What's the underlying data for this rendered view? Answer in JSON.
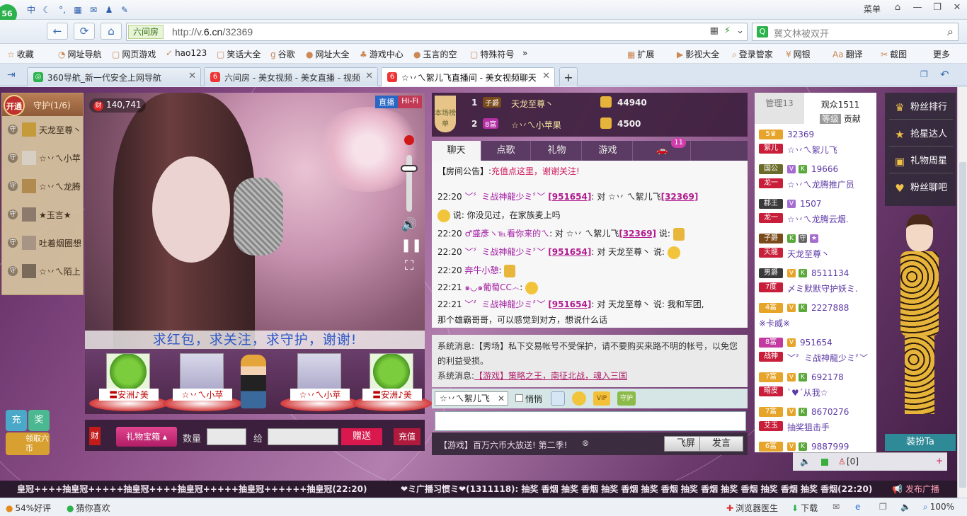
{
  "browser": {
    "logo_count": "56",
    "menu_label": "菜单",
    "toolbar_icons": [
      "中",
      "☾",
      "°,",
      "▦",
      "✉",
      "♟",
      "✎"
    ],
    "back": "←",
    "refresh": "⟳",
    "home": "⌂",
    "url_tag": "六间房",
    "url_prefix": "http://v.",
    "url_domain": "6.cn",
    "url_path": "/32369",
    "search_placeholder": "冀文林被双开",
    "favorites": [
      {
        "label": "收藏",
        "icon": "☆"
      },
      {
        "label": "网址导航",
        "icon": "◔"
      },
      {
        "label": "网页游戏",
        "icon": "▢"
      },
      {
        "label": "hao123",
        "icon": "✓"
      },
      {
        "label": "笑话大全",
        "icon": "▢"
      },
      {
        "label": "谷歌",
        "icon": "g"
      },
      {
        "label": "网址大全",
        "icon": "●"
      },
      {
        "label": "游戏中心",
        "icon": "♣"
      },
      {
        "label": "玉言的空",
        "icon": "●"
      },
      {
        "label": "特殊符号",
        "icon": "▢"
      },
      {
        "label": "»",
        "icon": ""
      }
    ],
    "right_favorites": [
      {
        "label": "扩展",
        "icon": "▦"
      },
      {
        "label": "影视大全",
        "icon": "▶"
      },
      {
        "label": "登录管家",
        "icon": "⌕"
      },
      {
        "label": "网银",
        "icon": "¥"
      },
      {
        "label": "翻译",
        "icon": "Aa"
      },
      {
        "label": "截图",
        "icon": "✂"
      },
      {
        "label": "更多",
        "icon": ""
      }
    ],
    "tabs": [
      {
        "title": "360导航_新一代安全上网导航",
        "icon": "◎"
      },
      {
        "title": "六间房 - 美女视频 - 美女直播 - 视频",
        "icon": "6"
      },
      {
        "title": "☆丷ㄟ絮儿飞直播间 - 美女视频聊天",
        "icon": "6"
      }
    ],
    "new_tab": "+"
  },
  "guard": {
    "open_label": "开通",
    "title": "守护(1/6)",
    "mark": "守",
    "members": [
      "天龙至尊丶",
      "☆丷ㄟ小苹",
      "☆丷ㄟ龙腾",
      "★玉言★",
      "吐着烟圈想",
      "☆丷ㄟ陌上"
    ]
  },
  "video": {
    "money_icon": "财",
    "money": "140,741",
    "live": "直播",
    "hifi": "Hi-Fi",
    "banner": "求红包，求关注，求守护，谢谢!",
    "vol_icon": "🔊",
    "pause_icon": "❚❚",
    "screen_icon": "⛶"
  },
  "seats": [
    {
      "name": "〓安洲♪美",
      "type": "alien"
    },
    {
      "name": "☆丷ㄟ小苹",
      "type": "girl"
    },
    {
      "name": "☆丷ㄟ小苹",
      "type": "girl"
    },
    {
      "name": "〓安洲♪美",
      "type": "alien"
    }
  ],
  "giftbar": {
    "cai": "财",
    "gift_box": "礼物宝箱 ▴",
    "qty_label": "数量",
    "to_label": "给",
    "send": "赠送",
    "charge": "充值"
  },
  "left_buttons": {
    "charge": "充",
    "prize": "奖",
    "collect": "领取六币"
  },
  "rank": {
    "badge": "本场榜单",
    "rows": [
      {
        "rank": "1",
        "level": "子爵",
        "name": "天龙至尊丶",
        "value": "44940"
      },
      {
        "rank": "2",
        "level": "8富",
        "name": "☆丷ㄟ小苹果",
        "value": "4500"
      }
    ]
  },
  "chat": {
    "tabs": [
      "聊天",
      "点歌",
      "礼物",
      "游戏",
      "🚗"
    ],
    "car_count": "11",
    "notice_prefix": "【房间公告】:",
    "notice": "充值点这里，谢谢关注!",
    "lines": [
      {
        "time": "22:20",
        "user": "﹀〞ミ战神龍少ミ〞﹀",
        "uid": "[951654]",
        "text": ": 对 ☆丷 ㄟ絮儿飞",
        "target_uid": "[32369]"
      },
      {
        "time": "",
        "user": "",
        "uid": "",
        "text": "说:  你没见过，在家族麦上吗",
        "target_uid": ""
      },
      {
        "time": "22:20",
        "user": "♂盛彥ヽ℡看你来的ㄟ",
        "uid": "",
        "text": ": 对 ☆丷 ㄟ絮儿飞",
        "target_uid": "[32369]",
        "tail": " 说: "
      },
      {
        "time": "22:20",
        "user": "﹀〞ミ战神龍少ミ〞﹀",
        "uid": "[951654]",
        "text": ": 对 天龙至尊丶 说: ",
        "target_uid": ""
      },
      {
        "time": "22:20",
        "user": "奔牛小憩",
        "uid": "",
        "text": ":",
        "target_uid": ""
      },
      {
        "time": "22:21",
        "user": "๑◡๑葡萄CC෴",
        "uid": "",
        "text": ":",
        "target_uid": ""
      },
      {
        "time": "22:21",
        "user": "﹀〞ミ战神龍少ミ〞﹀",
        "uid": "[951654]",
        "text": ": 对 天龙至尊丶 说: 我和军团,",
        "target_uid": ""
      },
      {
        "time": "",
        "user": "",
        "uid": "",
        "text": "那个雄霸哥哥，可以感觉到对方，想说什么话",
        "target_uid": ""
      }
    ]
  },
  "system": {
    "line1": "系统消息:【秀场】私下交易帐号不受保护，请不要购买来路不明的帐号，以免您的利益受损。",
    "line2_prefix": "系统消息:",
    "line2_link": "【游戏】策略之王，南征北战，魂入三国"
  },
  "input": {
    "target": "☆丷ㄟ絮儿飞",
    "close": "✕",
    "quiet": "悄悄",
    "vip": "VIP",
    "guard": "守护",
    "ad": "【游戏】百万六币大放送! 第二季!",
    "fly": "飞屏",
    "send": "发言"
  },
  "audience": {
    "admin": "管理13",
    "viewers": "观众1511",
    "sub_level": "等级",
    "sub_contrib": "贡献",
    "rows": [
      {
        "badge": "5♛",
        "id": "32369",
        "tag": "絮儿",
        "name": "☆丷ㄟ絮儿飞",
        "color": "#d33"
      },
      {
        "badge": "国公",
        "id": "19666",
        "tag": "龙一",
        "name": "☆丷ㄟ龙腾推广员",
        "color": "#6a3"
      },
      {
        "badge": "郡王",
        "id": "1507",
        "tag": "龙一",
        "name": "☆丷ㄟ龙腾云烟.",
        "color": "#444"
      },
      {
        "badge": "子爵",
        "id": "",
        "tag": "天龍",
        "name": "天龙至尊丶",
        "color": "#555"
      },
      {
        "badge": "男爵",
        "id": "8511134",
        "tag": "7度",
        "name": "〆ミ默默守护妖ミ.",
        "color": "#444"
      },
      {
        "badge": "4富",
        "id": "2227888",
        "tag": "",
        "name": "※卡威※",
        "color": "#e6a52a"
      },
      {
        "badge": "8富",
        "id": "951654",
        "tag": "战神",
        "name": "﹀〞ミ战神龍少ミ〞﹀",
        "color": "#c23aa0"
      },
      {
        "badge": "7富",
        "id": "692178",
        "tag": "暗皮",
        "name": "ˋ♥ˊ从我☆",
        "color": "#e6a52a"
      },
      {
        "badge": "7富",
        "id": "8670276",
        "tag": "艾玉",
        "name": "抽奖狙击手",
        "color": "#e6a52a"
      },
      {
        "badge": "6富",
        "id": "9887999",
        "tag": "",
        "name": "",
        "color": "#e6a52a"
      }
    ],
    "foot_user": "[0]"
  },
  "fans": {
    "items": [
      {
        "icon": "♛",
        "label": "粉丝排行"
      },
      {
        "icon": "★",
        "label": "抢星达人"
      },
      {
        "icon": "▣",
        "label": "礼物周星"
      },
      {
        "icon": "♥",
        "label": "粉丝聊吧"
      }
    ],
    "dress": "装扮Ta"
  },
  "ticker": {
    "left": "皇冠++++抽皇冠+++++抽皇冠++++抽皇冠+++++抽皇冠++++++抽皇冠(22:20)",
    "right": "❤ミ广播习惯ミ❤(1311118): 抽奖  香烟 抽奖 香烟 抽奖 香烟 抽奖 香烟 抽奖 香烟 抽奖 香烟 抽奖 香烟 抽奖 香烟(22:20)",
    "broadcast": "发布广播"
  },
  "statusbar": {
    "rating": "54%好评",
    "guess": "猜你喜欢",
    "doctor": "浏览器医生",
    "download": "下载",
    "zoom": "100%"
  }
}
